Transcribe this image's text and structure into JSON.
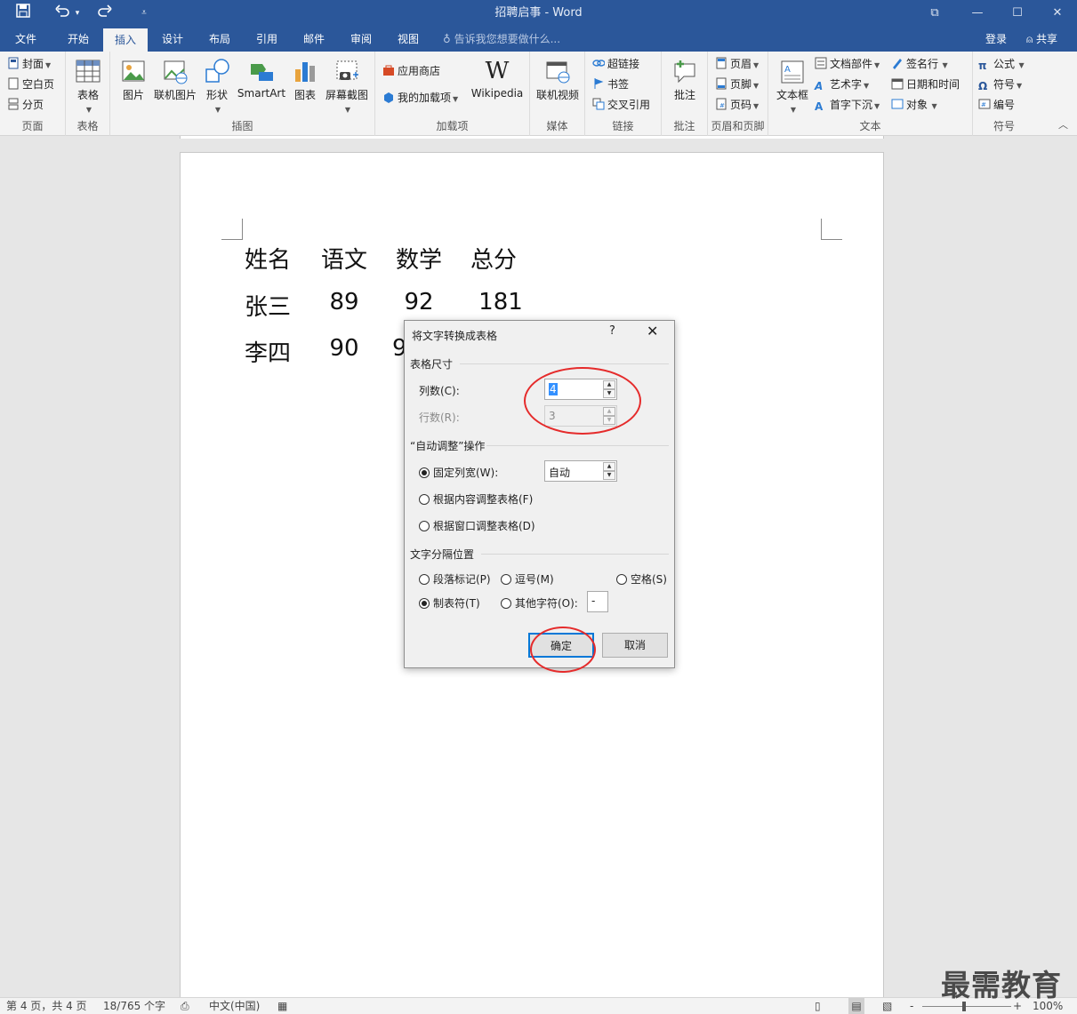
{
  "titlebar": {
    "title": "招聘启事 - Word",
    "save_icon": "save-icon",
    "undo_icon": "undo-icon",
    "redo_icon": "redo-icon",
    "min": "—",
    "max": "☐",
    "close": "✕",
    "ribbon_display": "⧉",
    "qa_more": "▾"
  },
  "tabs": [
    "文件",
    "开始",
    "插入",
    "设计",
    "布局",
    "引用",
    "邮件",
    "审阅",
    "视图"
  ],
  "active_tab": "插入",
  "tellme": "告诉我您想要做什么...",
  "login": "登录",
  "share": "共享",
  "ribbon": {
    "pages": {
      "label": "页面",
      "cover": "封面",
      "blank": "空白页",
      "break": "分页"
    },
    "tables": {
      "label": "表格",
      "table": "表格"
    },
    "illustrations": {
      "label": "插图",
      "picture": "图片",
      "online_picture": "联机图片",
      "shapes": "形状",
      "smartart": "SmartArt",
      "chart": "图表",
      "screenshot": "屏幕截图"
    },
    "addins": {
      "label": "加载项",
      "store": "应用商店",
      "my_addins": "我的加载项",
      "wikipedia": "Wikipedia"
    },
    "media": {
      "label": "媒体",
      "online_video": "联机视频"
    },
    "links": {
      "label": "链接",
      "hyperlink": "超链接",
      "bookmark": "书签",
      "cross_ref": "交叉引用"
    },
    "comments": {
      "label": "批注",
      "comment": "批注"
    },
    "header_footer": {
      "label": "页眉和页脚",
      "header": "页眉",
      "footer": "页脚",
      "page_number": "页码"
    },
    "text": {
      "label": "文本",
      "textbox": "文本框",
      "quick_parts": "文档部件",
      "wordart": "艺术字",
      "dropcap": "首字下沉",
      "signature": "签名行",
      "datetime": "日期和时间",
      "object": "对象"
    },
    "symbols": {
      "label": "符号",
      "equation": "公式",
      "symbol": "符号",
      "number": "编号"
    }
  },
  "document": {
    "rows": [
      [
        "姓名",
        "语文",
        "数学",
        "总分"
      ],
      [
        "张三",
        "89",
        "92",
        "181"
      ],
      [
        "李四",
        "90",
        "9"
      ]
    ]
  },
  "dialog": {
    "title": "将文字转换成表格",
    "help": "?",
    "close": "✕",
    "size_section": "表格尺寸",
    "cols_label": "列数(C):",
    "cols_value": "4",
    "rows_label": "行数(R):",
    "rows_value": "3",
    "autofit_section": "“自动调整”操作",
    "fixed_width": "固定列宽(W):",
    "fixed_width_value": "自动",
    "fit_content": "根据内容调整表格(F)",
    "fit_window": "根据窗口调整表格(D)",
    "separator_section": "文字分隔位置",
    "sep_paragraph": "段落标记(P)",
    "sep_comma": "逗号(M)",
    "sep_space": "空格(S)",
    "sep_tab": "制表符(T)",
    "sep_other": "其他字符(O):",
    "sep_other_value": "-",
    "ok": "确定",
    "cancel": "取消"
  },
  "status": {
    "page": "第 4 页，共 4 页",
    "words": "18/765 个字",
    "lang": "中文(中国)",
    "zoom": "100%",
    "zoom_minus": "-",
    "zoom_plus": "+"
  },
  "watermark": "最需教育",
  "colors": {
    "brand": "#2b579a",
    "highlight": "#e52b2b",
    "focus": "#0078d7"
  }
}
